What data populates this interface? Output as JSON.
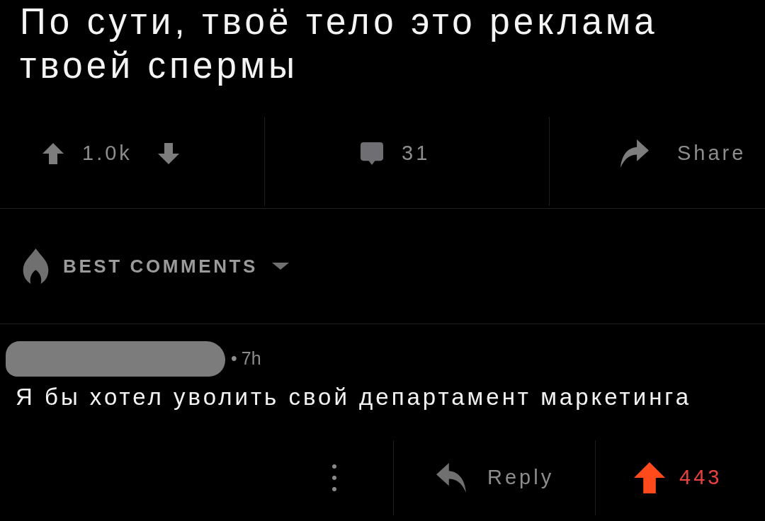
{
  "post": {
    "title": "По сути, твоё тело это реклама твоей спермы",
    "vote_count": "1.0k",
    "comment_count": "31",
    "share_label": "Share"
  },
  "comments_sort": {
    "label": "BEST COMMENTS"
  },
  "comments": [
    {
      "separator": "•",
      "time": "7h",
      "body": "Я бы хотел уволить свой департамент маркетинга",
      "reply_label": "Reply",
      "score": "443",
      "upvoted": true
    }
  ]
}
